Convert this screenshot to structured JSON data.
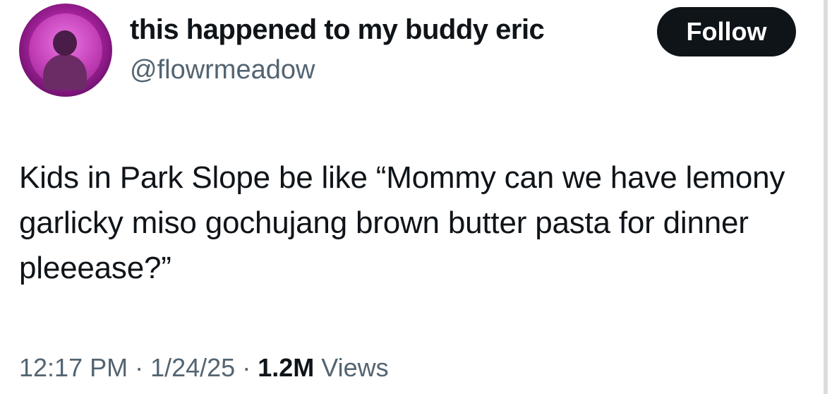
{
  "author": {
    "display_name": "this happened to my buddy eric",
    "handle": "@flowrmeadow",
    "avatar_icon": "profile-avatar"
  },
  "actions": {
    "follow_label": "Follow"
  },
  "tweet": {
    "text": "Kids in Park Slope be like “Mommy can we have lemony garlicky miso gochujang brown butter pasta for dinner pleeease?”"
  },
  "meta": {
    "time": "12:17 PM",
    "separator1": " · ",
    "date": "1/24/25",
    "separator2": " · ",
    "views_count": "1.2M",
    "views_label": " Views"
  },
  "colors": {
    "text": "#0f1419",
    "secondary": "#536471",
    "button_bg": "#0f1419",
    "button_text": "#ffffff"
  }
}
